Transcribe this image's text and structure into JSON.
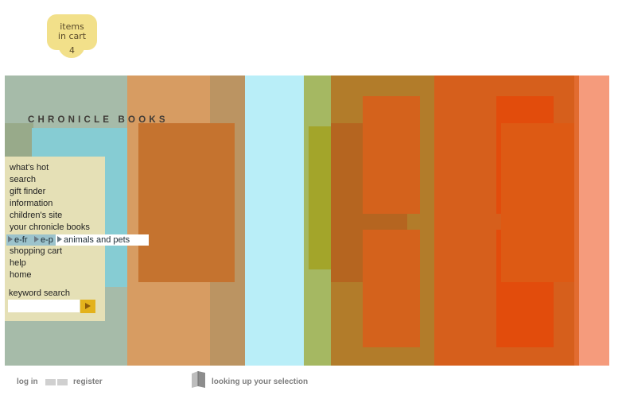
{
  "cart": {
    "line1": "items",
    "line2": "in cart",
    "count": "4"
  },
  "brand": "CHRONICLE BOOKS",
  "menu": {
    "items": [
      "what's hot",
      "search",
      "gift finder",
      "information",
      "children's site",
      "your chronicle books"
    ],
    "items_after": [
      "shopping cart",
      "help",
      "home"
    ],
    "breadcrumb": [
      "e-fr",
      "e-p",
      "animals and pets"
    ]
  },
  "search": {
    "label": "keyword search",
    "value": "",
    "placeholder": ""
  },
  "footer": {
    "login": "log in",
    "register": "register",
    "status": "looking up your selection"
  },
  "colors": {
    "cart_bubble": "#f2e08a",
    "menu_bg": "#e5e0b6",
    "search_button": "#e3b21c",
    "brand_text": "#3e3a36"
  }
}
